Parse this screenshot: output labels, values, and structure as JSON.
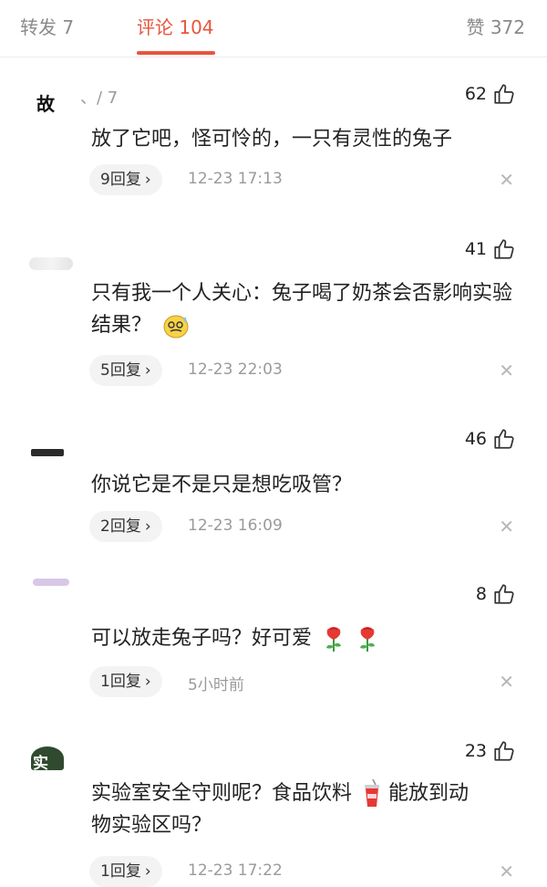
{
  "tabs": {
    "repost": "转发 7",
    "comments": "评论 104",
    "likes": "赞 372"
  },
  "comments": [
    {
      "avatar_text": "故",
      "username": "、/ 7",
      "likes": "62",
      "text": "放了它吧，怪可怜的，一只有灵性的兔子",
      "replies": "9回复",
      "time": "12-23 17:13"
    },
    {
      "avatar_text": "",
      "username": "",
      "likes": "41",
      "text": "只有我一个人关心：兔子喝了奶茶会否影响实验结果？",
      "replies": "5回复",
      "time": "12-23 22:03"
    },
    {
      "avatar_text": "",
      "username": "",
      "likes": "46",
      "text": "你说它是不是只是想吃吸管？",
      "replies": "2回复",
      "time": "12-23 16:09"
    },
    {
      "avatar_text": "",
      "username": "",
      "likes": "8",
      "text": "可以放走兔子吗？好可爱",
      "replies": "1回复",
      "time": "5小时前"
    },
    {
      "avatar_text": "实",
      "username": "",
      "likes": "23",
      "text_line1": "实验室安全守则呢？食品饮料",
      "text_line2": "能放到动",
      "text_line3": "物实验区吗？",
      "replies": "1回复",
      "time": "12-23 17:22"
    }
  ],
  "icons": {
    "thumb": "thumb-up-icon",
    "close": "close-icon",
    "emoji_sweat": "sweat-smile-emoji",
    "emoji_rose": "rose-emoji",
    "emoji_drink": "drink-cup-emoji"
  },
  "colors": {
    "accent": "#e8553e",
    "muted": "#9a9a9a",
    "pill_bg": "#f3f3f3"
  }
}
